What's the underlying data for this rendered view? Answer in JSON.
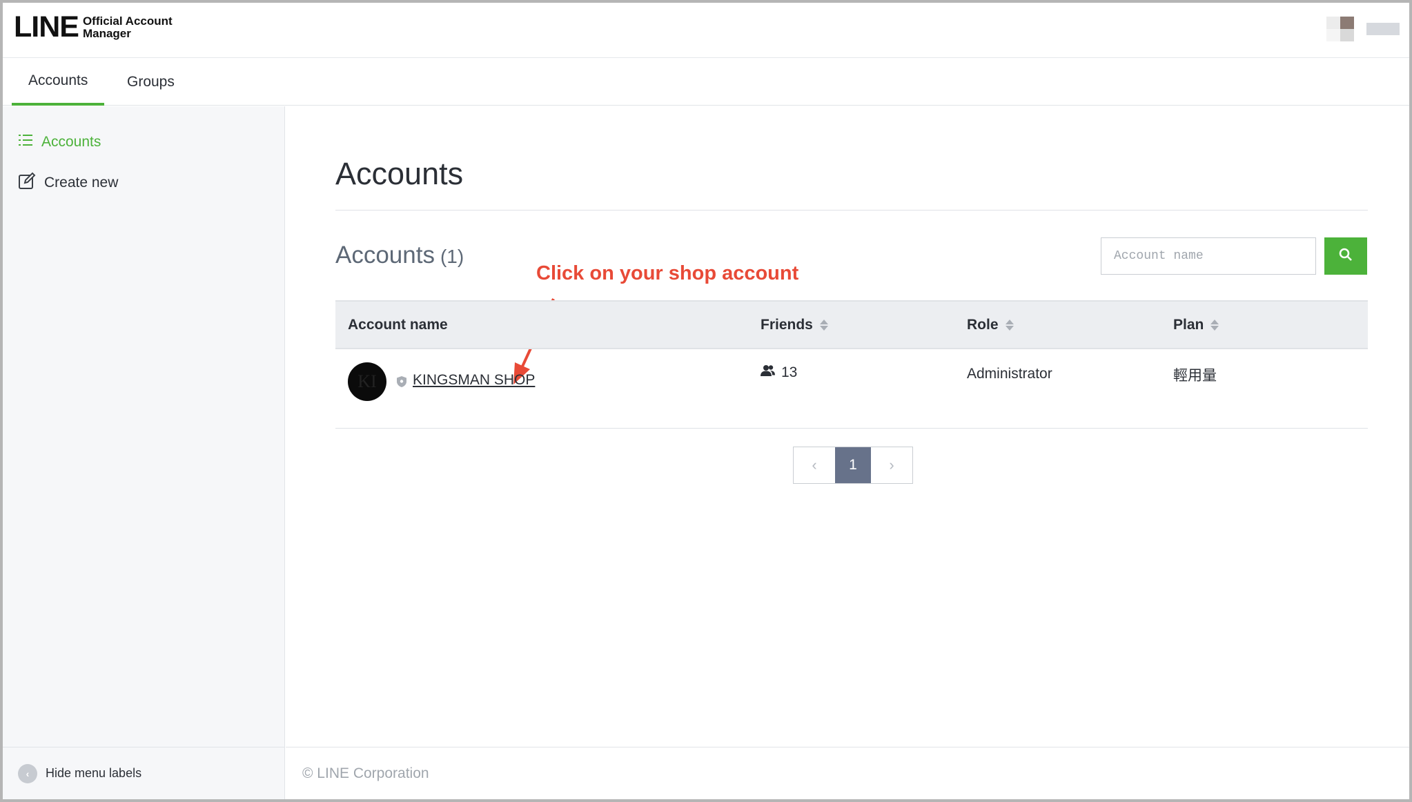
{
  "header": {
    "logo_text": "LINE",
    "logo_sub_line1": "Official Account",
    "logo_sub_line2": "Manager"
  },
  "tabs": [
    {
      "label": "Accounts",
      "active": true
    },
    {
      "label": "Groups",
      "active": false
    }
  ],
  "sidebar": {
    "items": [
      {
        "label": "Accounts",
        "icon": "list-icon",
        "active": true
      },
      {
        "label": "Create new",
        "icon": "edit-icon",
        "active": false
      }
    ],
    "footer_label": "Hide menu labels"
  },
  "main": {
    "page_title": "Accounts",
    "section_title": "Accounts",
    "section_count": "(1)",
    "search": {
      "placeholder": "Account name"
    },
    "annotation": "Click on your shop account",
    "table": {
      "columns": [
        "Account name",
        "Friends",
        "Role",
        "Plan"
      ],
      "rows": [
        {
          "avatar_initials": "KI",
          "name": "KINGSMAN SHOP",
          "friends": "13",
          "role": "Administrator",
          "plan": "輕用量"
        }
      ]
    },
    "pagination": {
      "prev": "‹",
      "current": "1",
      "next": "›"
    },
    "footer": "© LINE Corporation"
  },
  "colors": {
    "accent": "#4cb23a",
    "annotation": "#e84a37",
    "pager_current": "#67728a"
  }
}
